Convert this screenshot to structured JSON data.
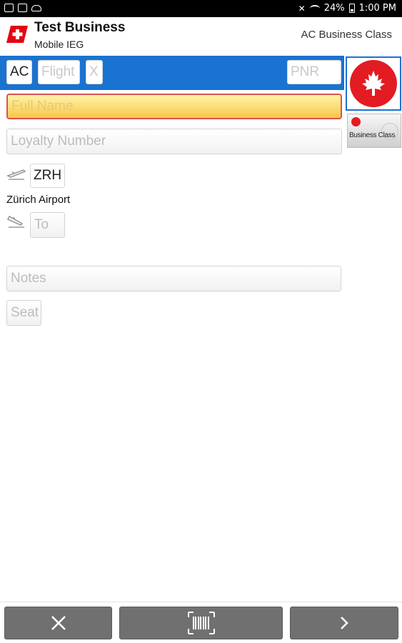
{
  "status_bar": {
    "battery": "24%",
    "time": "1:00 PM"
  },
  "header": {
    "title": "Test Business",
    "subtitle": "Mobile IEG",
    "class_label": "AC Business Class"
  },
  "flight": {
    "airline_code": "AC",
    "flight_placeholder": "Flight",
    "suffix_placeholder": "X",
    "pnr_placeholder": "PNR"
  },
  "passenger": {
    "full_name_placeholder": "Full Name",
    "loyalty_placeholder": "Loyalty Number"
  },
  "route": {
    "from_code": "ZRH",
    "from_airport": "Zürich Airport",
    "to_placeholder": "To"
  },
  "extra": {
    "notes_placeholder": "Notes",
    "seat_placeholder": "Seat"
  },
  "cabin_tile": {
    "label": "Business Class"
  },
  "colors": {
    "accent_blue": "#1a73d1",
    "airline_red": "#e31b23",
    "button_gray": "#707070"
  },
  "icons": {
    "takeoff": "plane-takeoff-icon",
    "landing": "plane-landing-icon",
    "cancel": "close-icon",
    "scan": "barcode-icon",
    "next": "chevron-right-icon"
  }
}
